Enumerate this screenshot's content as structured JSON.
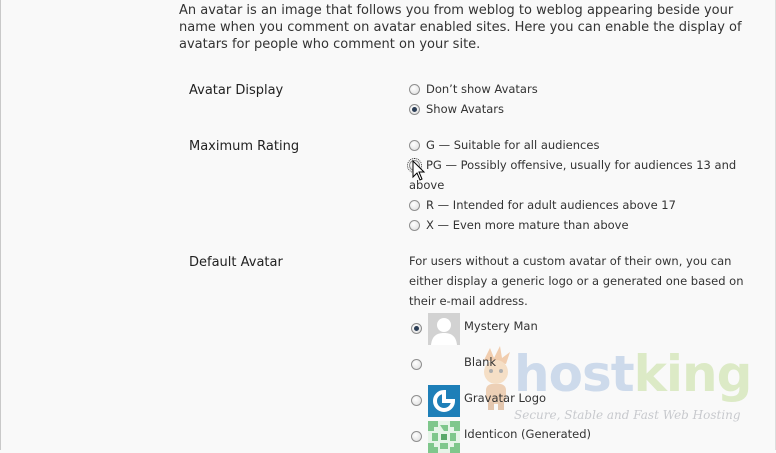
{
  "intro_text": "An avatar is an image that follows you from weblog to weblog appearing beside your name when you comment on avatar enabled sites. Here you can enable the display of avatars for people who comment on your site.",
  "avatar_display": {
    "label": "Avatar Display",
    "options": [
      {
        "label": "Don’t show Avatars",
        "checked": false
      },
      {
        "label": "Show Avatars",
        "checked": true
      }
    ]
  },
  "maximum_rating": {
    "label": "Maximum Rating",
    "options": [
      {
        "label": "G — Suitable for all audiences",
        "checked": false
      },
      {
        "label": "PG — Possibly offensive, usually for audiences 13 and above",
        "checked": false,
        "focused": true
      },
      {
        "label": "R — Intended for adult audiences above 17",
        "checked": false
      },
      {
        "label": "X — Even more mature than above",
        "checked": false
      }
    ]
  },
  "default_avatar": {
    "label": "Default Avatar",
    "description": "For users without a custom avatar of their own, you can either display a generic logo or a generated one based on their e-mail address.",
    "options": [
      {
        "label": "Mystery Man",
        "checked": true,
        "icon": "mystery-man-icon"
      },
      {
        "label": "Blank",
        "checked": false,
        "icon": "blank-icon"
      },
      {
        "label": "Gravatar Logo",
        "checked": false,
        "icon": "gravatar-logo-icon"
      },
      {
        "label": "Identicon (Generated)",
        "checked": false,
        "icon": "identicon-icon"
      }
    ]
  },
  "watermark": {
    "brand_part1": "host",
    "brand_part2": "king",
    "tagline": "Secure, Stable and Fast Web Hosting"
  },
  "colors": {
    "background": "#f9f9f9",
    "gravatar_blue": "#1e7fb8",
    "identicon_green": "#7fc78c"
  }
}
